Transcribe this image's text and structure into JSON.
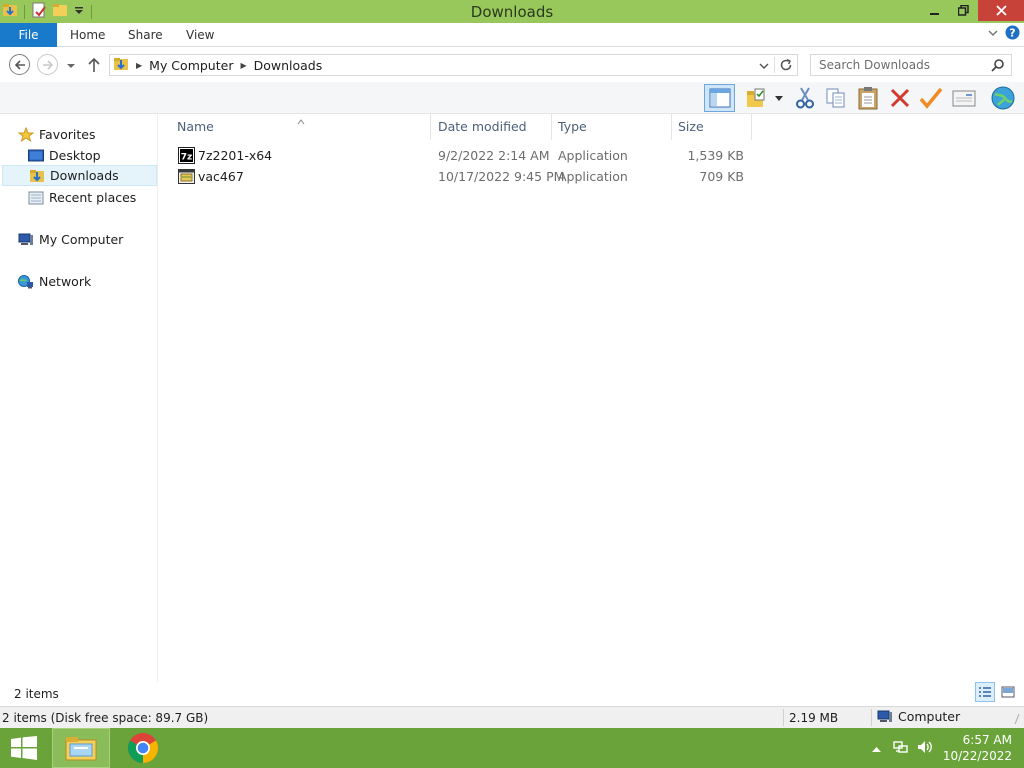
{
  "window": {
    "title": "Downloads"
  },
  "ribbon": {
    "tabs": [
      "File",
      "Home",
      "Share",
      "View"
    ]
  },
  "address": {
    "crumbs": [
      "My Computer",
      "Downloads"
    ],
    "search_placeholder": "Search Downloads"
  },
  "nav": {
    "favorites": "Favorites",
    "desktop": "Desktop",
    "downloads": "Downloads",
    "recent": "Recent places",
    "computer": "My Computer",
    "network": "Network"
  },
  "columns": {
    "name": "Name",
    "date": "Date modified",
    "type": "Type",
    "size": "Size"
  },
  "files": [
    {
      "name": "7z2201-x64",
      "date": "9/2/2022 2:14 AM",
      "type": "Application",
      "size": "1,539 KB",
      "icon": "7zip-installer-icon"
    },
    {
      "name": "vac467",
      "date": "10/17/2022 9:45 PM",
      "type": "Application",
      "size": "709 KB",
      "icon": "application-icon"
    }
  ],
  "pane_status": {
    "items": "2 items"
  },
  "statusbar": {
    "left": "2 items (Disk free space: 89.7 GB)",
    "size": "2.19 MB",
    "location": "Computer"
  },
  "taskbar": {
    "time": "6:57 AM",
    "date": "10/22/2022"
  },
  "colors": {
    "titlebar": "#98c85c",
    "file_tab": "#1979ca",
    "taskbar": "#6aa33a",
    "close": "#c7433a"
  }
}
